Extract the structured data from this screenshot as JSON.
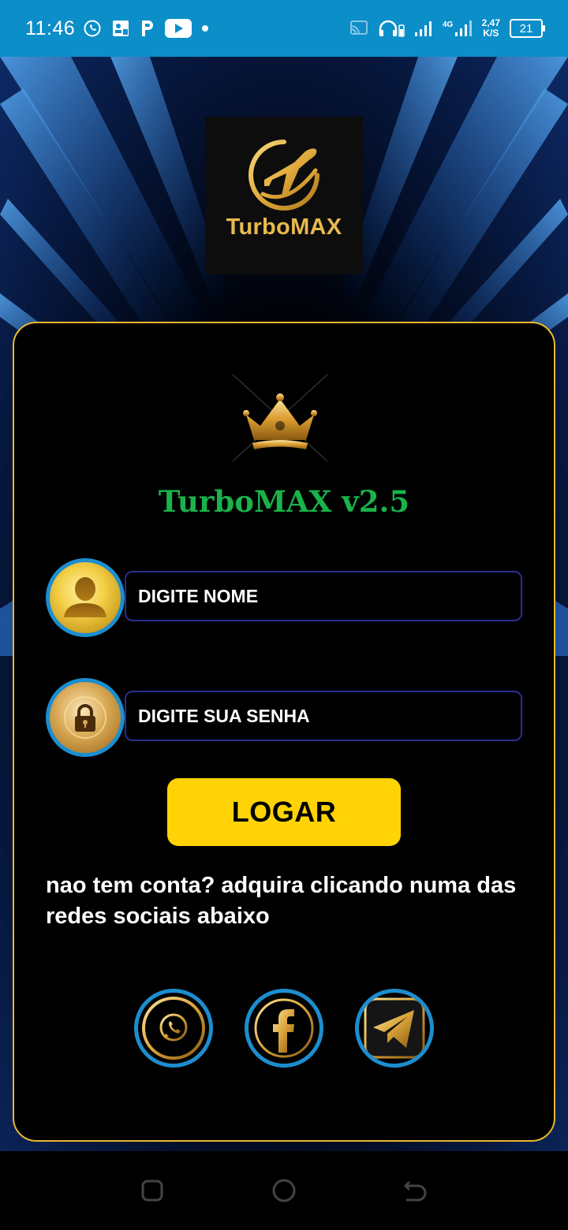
{
  "status_bar": {
    "time": "11:46",
    "left_icons": [
      "whatsapp-icon",
      "notification-app-icon",
      "paypal-icon",
      "youtube-icon",
      "dot-icon"
    ],
    "right_icons": [
      "cast-icon",
      "headset-icon",
      "signal-icon",
      "4g-signal-icon"
    ],
    "network_speed_value": "2,47",
    "network_speed_unit": "K/S",
    "battery_level": "21"
  },
  "brand": {
    "name": "TurboMAX",
    "logo_icon": "airplane-icon",
    "accent_color": "#e8b94f"
  },
  "card": {
    "emblem_icon": "crown-icon",
    "title": "TurboMAX v2.5",
    "title_color": "#19b34a",
    "border_color": "#e9b92c"
  },
  "form": {
    "name_field": {
      "icon": "user-icon",
      "placeholder": "DIGITE NOME",
      "value": ""
    },
    "password_field": {
      "icon": "lock-icon",
      "placeholder": "DIGITE SUA SENHA",
      "value": ""
    },
    "login_button": {
      "label": "LOGAR",
      "color": "#ffd305"
    }
  },
  "info_text": "nao tem conta? adquira clicando numa das redes sociais abaixo",
  "social": [
    {
      "name": "WhatsApp",
      "icon": "whatsapp-icon"
    },
    {
      "name": "Facebook",
      "icon": "facebook-icon"
    },
    {
      "name": "Telegram",
      "icon": "telegram-icon"
    }
  ],
  "nav_bar": {
    "buttons": [
      "recent-apps-icon",
      "home-icon",
      "back-icon"
    ]
  }
}
